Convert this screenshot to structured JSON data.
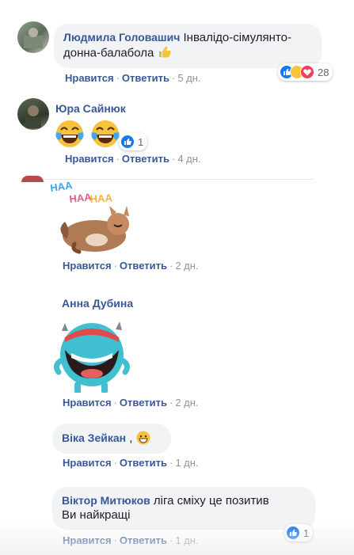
{
  "comments": [
    {
      "author": "Людмила Головашич",
      "text_line1": "Інвалідо-сімулянто-",
      "text_line2": "донна-балабола",
      "emoji": "thumb-emoji",
      "reactions": {
        "icons": [
          "like-icon",
          "haha-icon",
          "love-icon"
        ],
        "count": "28"
      },
      "like": "Нравится",
      "reply": "Ответить",
      "time": "5 дн."
    },
    {
      "author": "Юра Сайнюк",
      "emoji": "laughing-crying-emoji",
      "reactions": {
        "icons": [
          "like-icon"
        ],
        "count": "1"
      },
      "like": "Нравится",
      "reply": "Ответить",
      "time": "4 дн."
    },
    {
      "sticker": "haa-fox-laughing-sticker",
      "sticker_text": [
        "HAA",
        "HAA",
        "HAA"
      ],
      "like": "Нравится",
      "reply": "Ответить",
      "time": "2 дн."
    },
    {
      "author": "Анна Дубина",
      "sticker": "blue-monster-laughing-sticker",
      "like": "Нравится",
      "reply": "Ответить",
      "time": "2 дн."
    },
    {
      "author": "Віка Зейкан",
      "text": ",",
      "emoji": "grin-emoji",
      "like": "Нравится",
      "reply": "Ответить",
      "time": "1 дн."
    },
    {
      "author": "Віктор Митюков",
      "text_line1": "ліга сміху це позитив",
      "text_line2": "Ви найкращі",
      "reactions": {
        "icons": [
          "like-icon"
        ],
        "count": "1"
      },
      "like": "Нравится",
      "reply": "Ответить",
      "time": "1 дн."
    }
  ],
  "colors": {
    "link": "#385898",
    "bubble": "#f2f3f5",
    "like_blue": "#1877f2",
    "love_red": "#f33e58",
    "haha_yellow": "#f7c33d"
  }
}
